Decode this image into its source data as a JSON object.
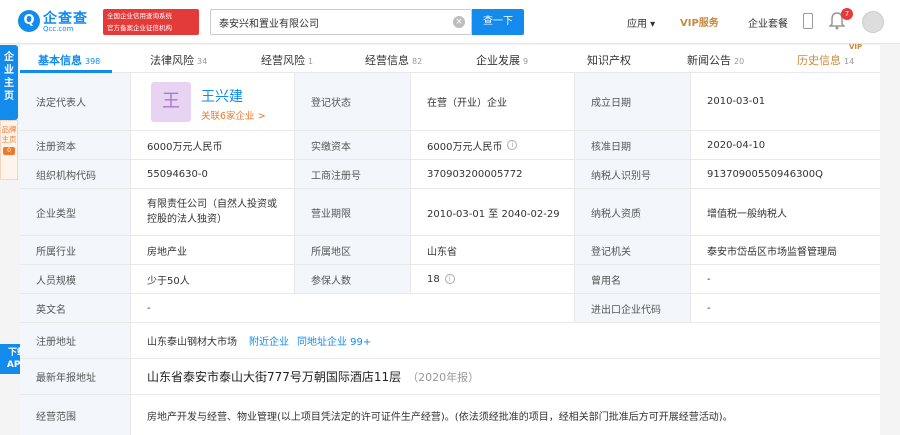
{
  "header": {
    "logo_glyph": "Q",
    "logo_name": "企查查",
    "logo_domain": "Qcc.com",
    "badge_line1": "全国企业信用查询系统",
    "badge_line2": "官方备案企业征信机构",
    "search_value": "泰安兴和置业有限公司",
    "search_clear": "×",
    "search_button": "查一下",
    "nav_apps": "应用 ▾",
    "nav_vip": "VIP服务",
    "nav_enterprise": "企业套餐",
    "bell_count": "7"
  },
  "sidebar": {
    "home_label": "企业主页",
    "brand_label": "品牌主页",
    "brand_count": "0",
    "download_label_1": "下载",
    "download_label_2": "APP"
  },
  "tabs": [
    {
      "label": "基本信息",
      "count": "398"
    },
    {
      "label": "法律风险",
      "count": "34"
    },
    {
      "label": "经营风险",
      "count": "1"
    },
    {
      "label": "经营信息",
      "count": "82"
    },
    {
      "label": "企业发展",
      "count": "9"
    },
    {
      "label": "知识产权",
      "count": ""
    },
    {
      "label": "新闻公告",
      "count": "20"
    },
    {
      "label": "历史信息",
      "count": "14"
    }
  ],
  "vip_mark": "VIP",
  "info": {
    "legal_rep_label": "法定代表人",
    "legal_rep_avatar": "王",
    "legal_rep_name": "王兴建",
    "legal_rep_related": "关联6家企业 >",
    "reg_status_label": "登记状态",
    "reg_status": "在营（开业）企业",
    "established_label": "成立日期",
    "established": "2010-03-01",
    "reg_capital_label": "注册资本",
    "reg_capital": "6000万元人民币",
    "paid_capital_label": "实缴资本",
    "paid_capital": "6000万元人民币",
    "approval_date_label": "核准日期",
    "approval_date": "2020-04-10",
    "org_code_label": "组织机构代码",
    "org_code": "55094630-0",
    "biz_reg_no_label": "工商注册号",
    "biz_reg_no": "370903200005772",
    "taxpayer_id_label": "纳税人识别号",
    "taxpayer_id": "91370900550946300Q",
    "company_type_label": "企业类型",
    "company_type": "有限责任公司（自然人投资或控股的法人独资）",
    "term_label": "营业期限",
    "term": "2010-03-01 至 2040-02-29",
    "taxpayer_qual_label": "纳税人资质",
    "taxpayer_qual": "增值税一般纳税人",
    "industry_label": "所属行业",
    "industry": "房地产业",
    "region_label": "所属地区",
    "region": "山东省",
    "reg_authority_label": "登记机关",
    "reg_authority": "泰安市岱岳区市场监督管理局",
    "staff_size_label": "人员规模",
    "staff_size": "少于50人",
    "insured_label": "参保人数",
    "insured": "18",
    "former_name_label": "曾用名",
    "former_name": "-",
    "english_name_label": "英文名",
    "english_name": "-",
    "import_export_label": "进出口企业代码",
    "import_export": "-",
    "reg_address_label": "注册地址",
    "reg_address": "山东泰山钢材大市场",
    "nearby_link": "附近企业",
    "same_address_link": "同地址企业 99+",
    "annual_addr_label": "最新年报地址",
    "annual_addr": "山东省泰安市泰山大街777号万朝国际酒店11层",
    "annual_year": "（2020年报）",
    "scope_label": "经营范围",
    "scope": "房地产开发与经营、物业管理(以上项目凭法定的许可证件生产经营)。(依法须经批准的项目，经相关部门批准后方可开展经营活动)。"
  },
  "colors": {
    "brand_blue": "#128bed",
    "label_bg": "#f3f7fc",
    "vip_gold": "#c8893c",
    "alert_red": "#e53a3a",
    "link_orange": "#ef7a2c"
  }
}
